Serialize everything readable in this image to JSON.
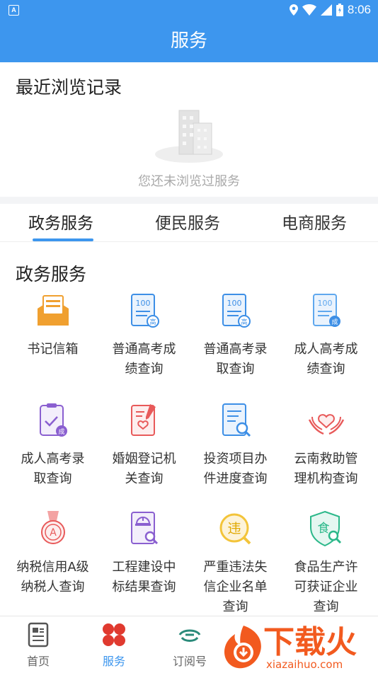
{
  "status": {
    "time": "8:06",
    "app_badge": "A"
  },
  "header": {
    "title": "服务"
  },
  "recent": {
    "title": "最近浏览记录",
    "empty_text": "您还未浏览过服务"
  },
  "tabs": [
    {
      "label": "政务服务",
      "active": true
    },
    {
      "label": "便民服务",
      "active": false
    },
    {
      "label": "电商服务",
      "active": false
    }
  ],
  "section": {
    "title": "政务服务"
  },
  "services": [
    {
      "label": "书记信箱",
      "icon": "mailbox-icon"
    },
    {
      "label": "普通高考成绩查询",
      "icon": "exam-score-icon"
    },
    {
      "label": "普通高考录取查询",
      "icon": "exam-admission-icon"
    },
    {
      "label": "成人高考成绩查询",
      "icon": "adult-exam-score-icon"
    },
    {
      "label": "成人高考录取查询",
      "icon": "adult-exam-admission-icon"
    },
    {
      "label": "婚姻登记机关查询",
      "icon": "marriage-registry-icon"
    },
    {
      "label": "投资项目办件进度查询",
      "icon": "investment-progress-icon"
    },
    {
      "label": "云南救助管理机构查询",
      "icon": "relief-agency-icon"
    },
    {
      "label": "纳税信用A级纳税人查询",
      "icon": "tax-credit-icon"
    },
    {
      "label": "工程建设中标结果查询",
      "icon": "construction-bid-icon"
    },
    {
      "label": "严重违法失信企业名单查询",
      "icon": "violation-list-icon"
    },
    {
      "label": "食品生产许可获证企业查询",
      "icon": "food-license-icon"
    }
  ],
  "bottom_nav": [
    {
      "label": "首页",
      "icon": "home-doc-icon",
      "active": false
    },
    {
      "label": "服务",
      "icon": "service-grid-icon",
      "active": true
    },
    {
      "label": "订阅号",
      "icon": "subscription-icon",
      "active": false
    }
  ],
  "watermark": {
    "text": "下载火",
    "url_text": "xiazaihuo.com"
  },
  "colors": {
    "primary": "#3d96ee",
    "orange": "#f0a030",
    "blue": "#3d8fe6",
    "purple": "#8a5fd0",
    "red": "#e85a5a",
    "yellow": "#f3c43a",
    "green": "#2cb88a",
    "nav_red": "#e03a2f"
  }
}
